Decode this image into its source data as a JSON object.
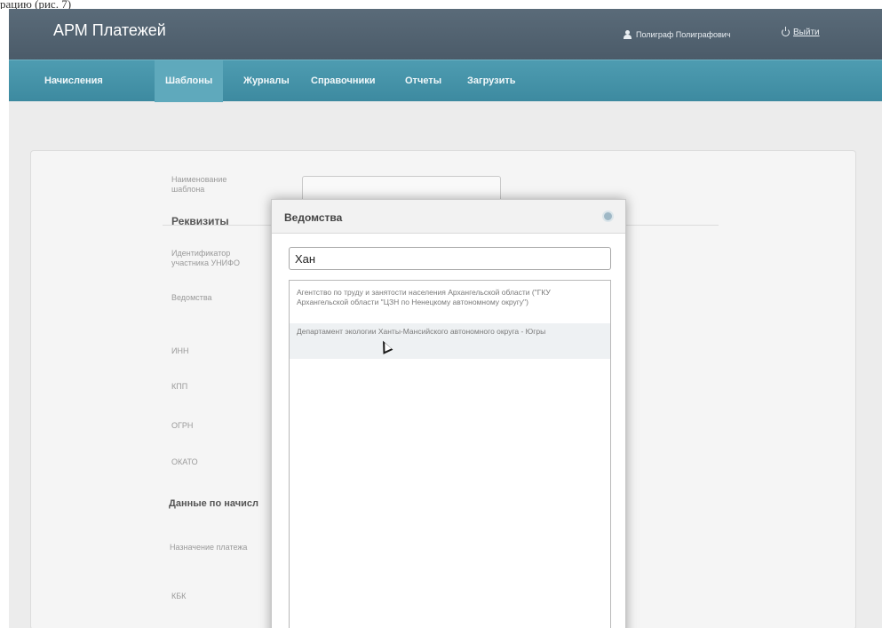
{
  "caption": "рацию (рис. 7)",
  "header": {
    "title": "АРМ Платежей",
    "user": "Полиграф Полиграфович",
    "logout": "Выйти"
  },
  "nav": [
    "Начисления",
    "Шаблоны",
    "Журналы",
    "Справочники",
    "Отчеты",
    "Загрузить"
  ],
  "form": {
    "template_name_label": "Наименование шаблона",
    "requisites_heading": "Реквизиты",
    "participant_id_label": "Идентификатор участника УНИФО",
    "department_label": "Ведомства",
    "inn_label": "ИНН",
    "kpp_label": "КПП",
    "ogrn_label": "ОГРН",
    "okato_label": "ОКАТО",
    "charge_heading": "Данные по начисл",
    "payment_purpose_label": "Назначение платежа",
    "kbk_label": "КБК"
  },
  "modal": {
    "title": "Ведомства",
    "search_value": "Хан",
    "results": [
      "Агентство по труду и занятости населения Архангельской области (\"ГКУ Архангельской области \"ЦЗН по Ненецкому автономному округу\")",
      "Департамент экологии Ханты-Мансийского автономного округа - Югры"
    ]
  },
  "icons": {
    "user": "user-icon",
    "logout": "power-icon",
    "close": "close-icon",
    "cursor": "mouse-cursor-icon"
  },
  "colors": {
    "topbar": "#4f606e",
    "navbar": "#4596ab",
    "nav_active": "#5fa9bc"
  }
}
